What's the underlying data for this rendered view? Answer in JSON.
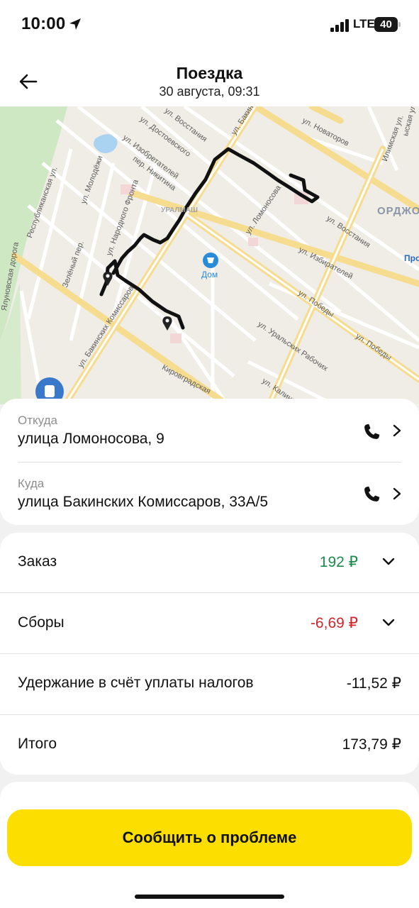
{
  "status_bar": {
    "time": "10:00",
    "network": "LTE",
    "battery": "40"
  },
  "header": {
    "title": "Поездка",
    "subtitle": "30 августа, 09:31"
  },
  "map": {
    "street_labels": [
      "ул. Восстания",
      "ул. Достоевского",
      "ул. Изобретателей",
      "пер. Никитина",
      "ул. Молодёжи",
      "Республиканская ул.",
      "ул. Народного Фронта",
      "Зелёный пер.",
      "ул. Бакинских Комиссаров",
      "ул. Ломоносова",
      "ул. Новаторов",
      "Илимская ул.",
      "ул. Восстания",
      "ул. Избирателей",
      "ул. Победы",
      "ул. Победы",
      "ул. Уральских Рабочих",
      "ул. Калинина",
      "Кировградская",
      "Ялуновская дорога",
      "ул. Бакинских К",
      "ыская ул."
    ],
    "district_labels": [
      "УРАЛМАШ",
      "ОРДЖО",
      "Про"
    ],
    "poi_label": "Дом"
  },
  "route": {
    "from_label": "Откуда",
    "from_address": "улица Ломоносова, 9",
    "to_label": "Куда",
    "to_address": "улица Бакинских Комиссаров, 33А/5"
  },
  "price": {
    "rows": [
      {
        "label": "Заказ",
        "value": "192 ₽",
        "color": "#1f8a4c"
      },
      {
        "label": "Сборы",
        "value": "-6,69 ₽",
        "color": "#d0262b"
      },
      {
        "label": "Удержание в счёт уплаты налогов",
        "value": "-11,52 ₽",
        "color": "#111111"
      },
      {
        "label": "Итого",
        "value": "173,79 ₽",
        "color": "#111111"
      }
    ]
  },
  "actions": {
    "report_problem": "Сообщить о проблеме"
  },
  "colors": {
    "accent_yellow": "#fcdf00",
    "positive": "#1f8a4c",
    "negative": "#d0262b"
  }
}
